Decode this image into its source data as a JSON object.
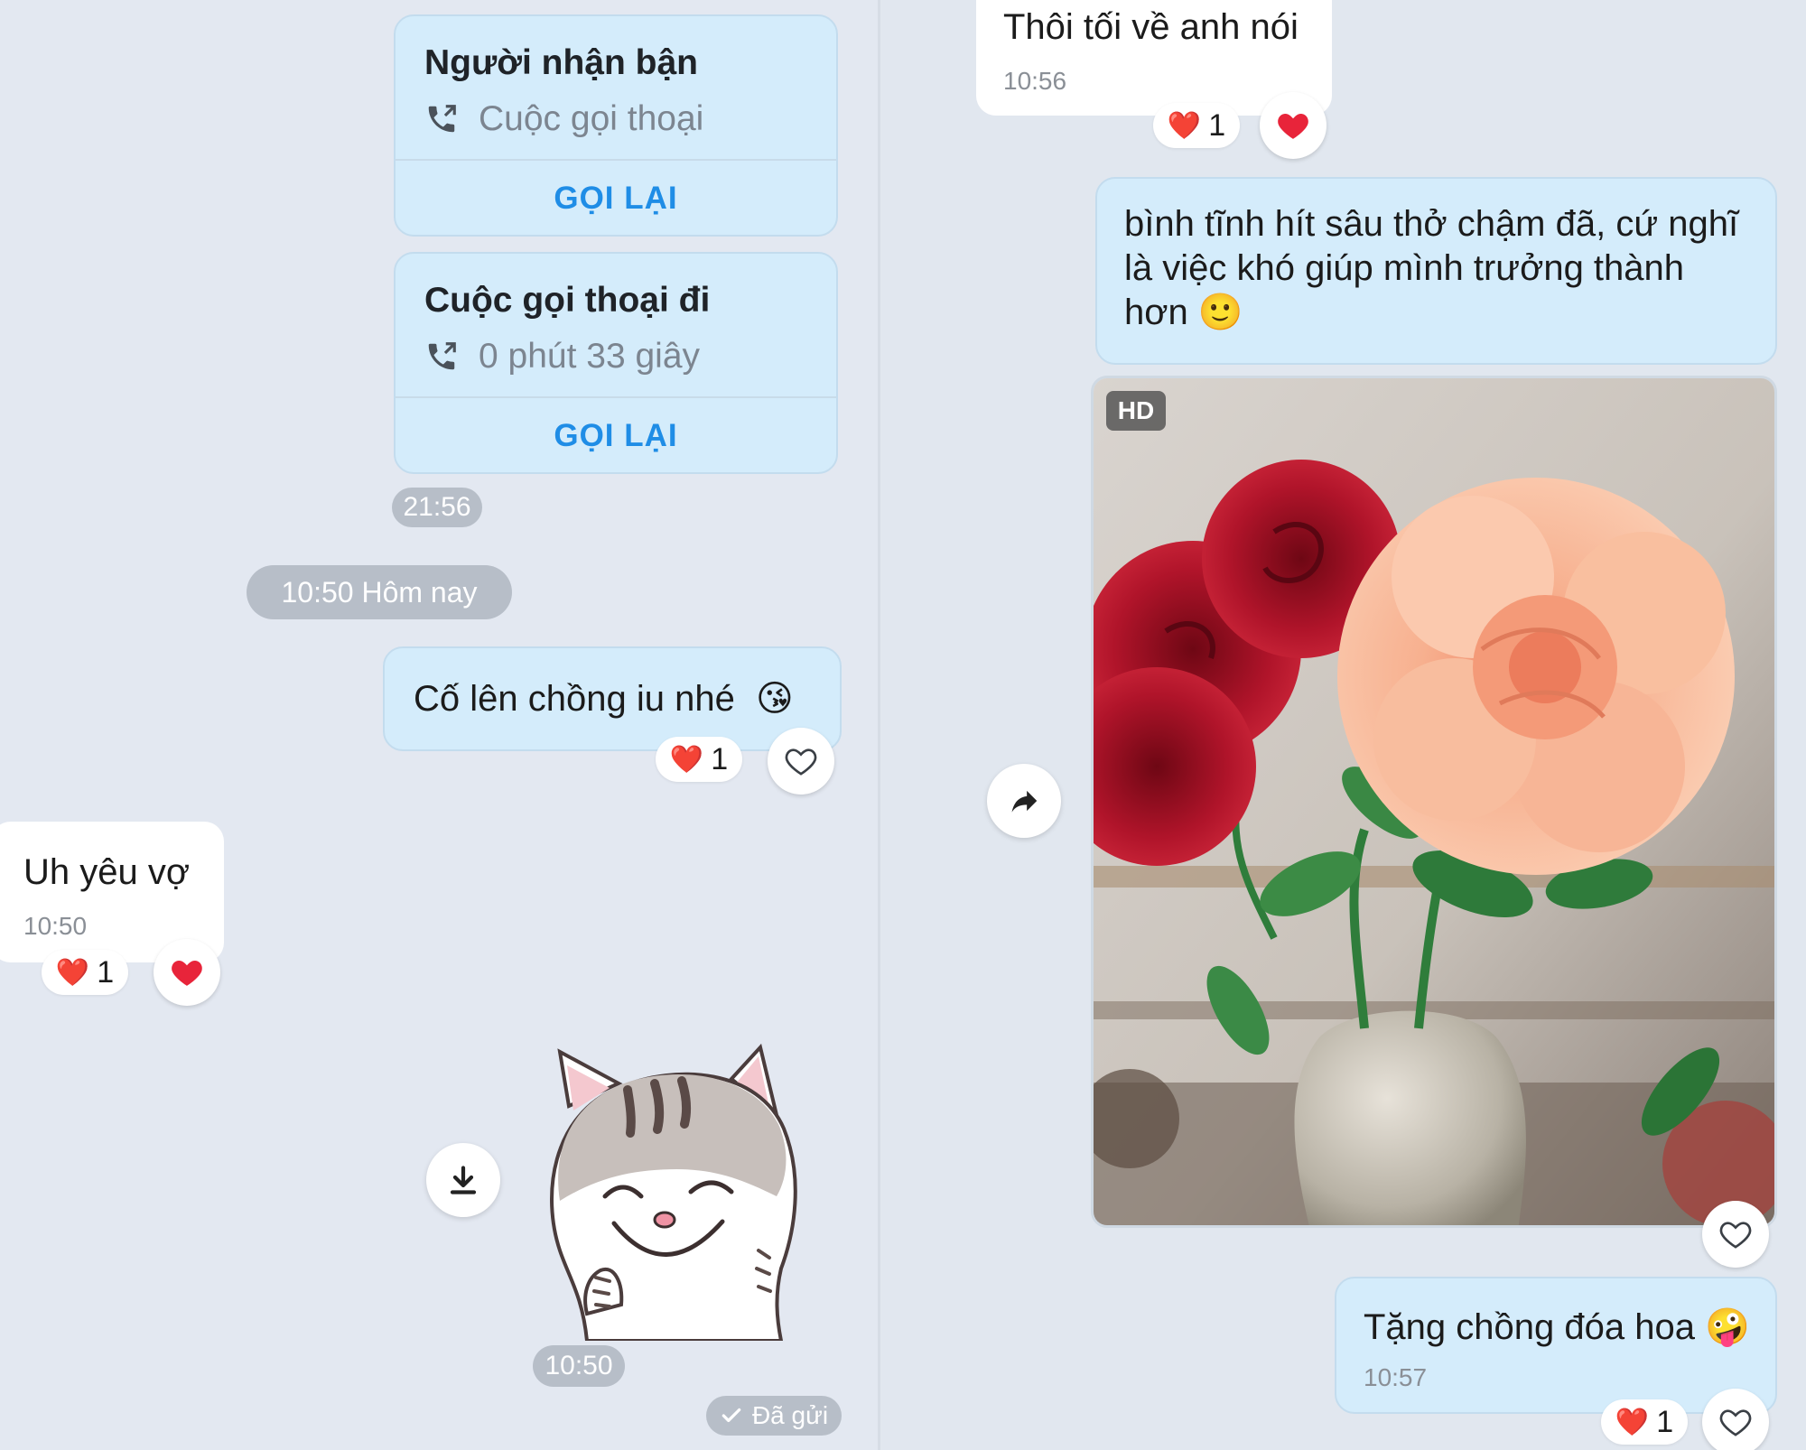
{
  "left": {
    "call_incoming": {
      "title": "Người nhận bận",
      "subtitle": "Cuộc gọi thoại",
      "action": "GỌI LẠI",
      "icon": "phone-icon"
    },
    "call_outgoing": {
      "title": "Cuộc gọi thoại đi",
      "subtitle": "0 phút 33 giây",
      "action": "GỌI LẠI",
      "icon": "phone-icon"
    },
    "calls_time": "21:56",
    "date_separator": "10:50 Hôm nay",
    "msg_me": {
      "text": "Cố lên chồng iu nhé",
      "emoji": "😘",
      "reaction_emoji": "❤️",
      "reaction_count": "1"
    },
    "msg_other": {
      "text": "Uh yêu vợ",
      "time": "10:50",
      "reaction_emoji": "❤️",
      "reaction_count": "1"
    },
    "sticker": {
      "time": "10:50",
      "icon": "download-icon"
    },
    "status": {
      "icon": "check-icon",
      "label": "Đã gửi"
    }
  },
  "right": {
    "msg_other_top": {
      "text": "Thôi tối về anh nói",
      "time": "10:56",
      "reaction_emoji": "❤️",
      "reaction_count": "1"
    },
    "msg_me_long": {
      "text": "bình tĩnh hít sâu thở chậm đã, cứ nghĩ là việc khó giúp mình trưởng thành hơn",
      "emoji": "🙂"
    },
    "photo": {
      "badge": "HD",
      "forward_icon": "forward-icon",
      "like_icon": "heart-outline-icon"
    },
    "msg_me_flower": {
      "text": "Tặng chồng đóa hoa",
      "emoji": "🤪",
      "time": "10:57",
      "reaction_emoji": "❤️",
      "reaction_count": "1"
    }
  },
  "colors": {
    "background": "#e2e8f1",
    "my_bubble": "#d4ecfb",
    "other_bubble": "#ffffff",
    "action_blue": "#1f8de6",
    "heart_red": "#e8243a"
  }
}
